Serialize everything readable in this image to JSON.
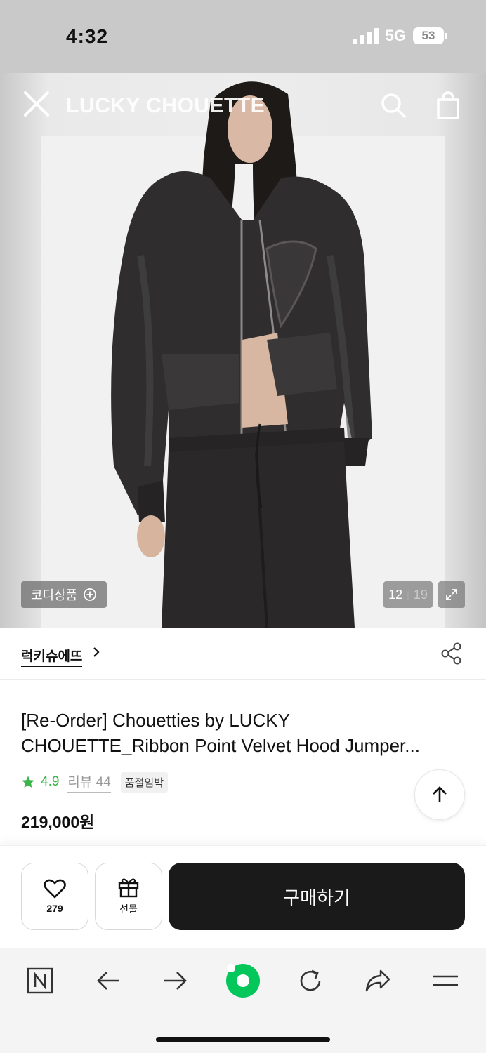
{
  "status_bar": {
    "time": "4:32",
    "network": "5G",
    "battery": "53"
  },
  "header": {
    "brand": "LUCKY CHOUETTE"
  },
  "hero": {
    "coordi_label": "코디상품",
    "current_image": "12",
    "total_images": "19"
  },
  "brand_row": {
    "brand_name": "럭키슈에뜨"
  },
  "product": {
    "title_line1": "[Re-Order] Chouetties by LUCKY",
    "title_line2": "CHOUETTE_Ribbon Point Velvet Hood Jumper...",
    "rating": "4.9",
    "review_label": "리뷰 44",
    "badge": "품절임박",
    "price": "219,000원"
  },
  "actions": {
    "like_count": "279",
    "gift_label": "선물",
    "buy_label": "구매하기"
  },
  "colors": {
    "rating_green": "#3bb449",
    "buy_bg": "#1a1a1a",
    "naver_green": "#03c75a"
  },
  "browser_bar": {
    "icons": [
      "naver-n-icon",
      "back-arrow-icon",
      "forward-arrow-icon",
      "naver-green-dot-icon",
      "refresh-icon",
      "share-arrow-icon",
      "menu-icon"
    ]
  }
}
